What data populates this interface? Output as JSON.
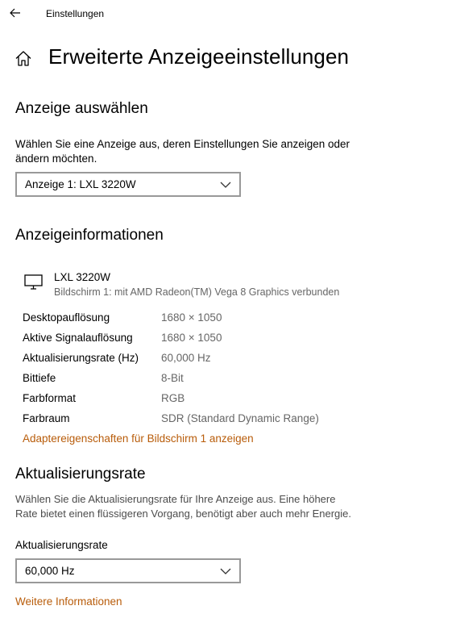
{
  "window": {
    "title": "Einstellungen"
  },
  "page": {
    "title": "Erweiterte Anzeigeeinstellungen"
  },
  "select_display": {
    "heading": "Anzeige auswählen",
    "description_line1": "Wählen Sie eine Anzeige aus, deren Einstellungen Sie anzeigen oder",
    "description_line2": "ändern möchten.",
    "dropdown_value": "Anzeige 1: LXL 3220W"
  },
  "display_info": {
    "heading": "Anzeigeinformationen",
    "monitor_name": "LXL 3220W",
    "monitor_subtitle": "Bildschirm 1: mit AMD Radeon(TM) Vega 8 Graphics verbunden",
    "rows": [
      {
        "label": "Desktopauflösung",
        "value": "1680 × 1050"
      },
      {
        "label": "Aktive Signalauflösung",
        "value": "1680 × 1050"
      },
      {
        "label": "Aktualisierungsrate (Hz)",
        "value": "60,000 Hz"
      },
      {
        "label": "Bittiefe",
        "value": "8-Bit"
      },
      {
        "label": "Farbformat",
        "value": "RGB"
      },
      {
        "label": "Farbraum",
        "value": "SDR (Standard Dynamic Range)"
      }
    ],
    "adapter_link": "Adaptereigenschaften für Bildschirm 1 anzeigen"
  },
  "refresh_rate": {
    "heading": "Aktualisierungsrate",
    "description_line1": "Wählen Sie die Aktualisierungsrate für Ihre Anzeige aus. Eine höhere",
    "description_line2": "Rate bietet einen flüssigeren Vorgang, benötigt aber auch mehr Energie.",
    "dropdown_label": "Aktualisierungsrate",
    "dropdown_value": "60,000 Hz",
    "more_info_link": "Weitere Informationen"
  },
  "colors": {
    "link": "#b85c0a",
    "muted": "#666666",
    "border": "#999999"
  }
}
